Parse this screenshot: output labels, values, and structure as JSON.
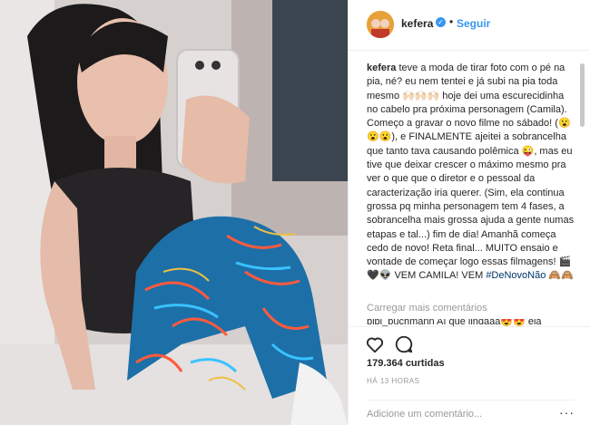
{
  "post": {
    "username": "kefera",
    "separator": "•",
    "follow_label": "Seguir",
    "verified_glyph": "✓",
    "caption": {
      "username": "kefera",
      "text": " teve a moda de tirar foto com o pé na pia, né? eu nem tentei e já subi na pia toda mesmo 🙌🏻🙌🏻🙌🏻 hoje dei uma escurecidinha no cabelo pra próxima personagem (Camila). Começo a gravar o novo filme no sábado! (😮😮😮), e FINALMENTE ajeitei a sobrancelha que tanto tava causando polêmica 😜, mas eu tive que deixar crescer o máximo mesmo pra ver o que que o diretor e o pessoal da caracterização iria querer. (Sim, ela continua grossa pq minha personagem tem 4 fases, a sobrancelha mais grossa ajuda a gente numas etapas e tal...) fim de dia! Amanhã começa cedo de novo! Reta final... MUITO ensaio e vontade de começar logo essas filmagens! 🎬🖤👽 VEM CAMILA! VEM ",
      "hashtag": "#DeNovoNão",
      "end": " 🙈🙈"
    },
    "load_more_label": "Carregar mais comentários",
    "partial_comment": "bibi_buchmann Aí que lindaaa😍😍 ela",
    "likes": "179.364 curtidas",
    "time_ago": "HÁ 13 HORAS",
    "comment_placeholder": "Adicione um comentário...",
    "options_label": "···",
    "icons": {
      "like": "heart-icon",
      "comment": "comment-bubble-icon",
      "options": "more-options-icon"
    },
    "colors": {
      "link": "#3897f0",
      "muted": "#999999",
      "text": "#262626",
      "hashtag": "#003569"
    }
  }
}
